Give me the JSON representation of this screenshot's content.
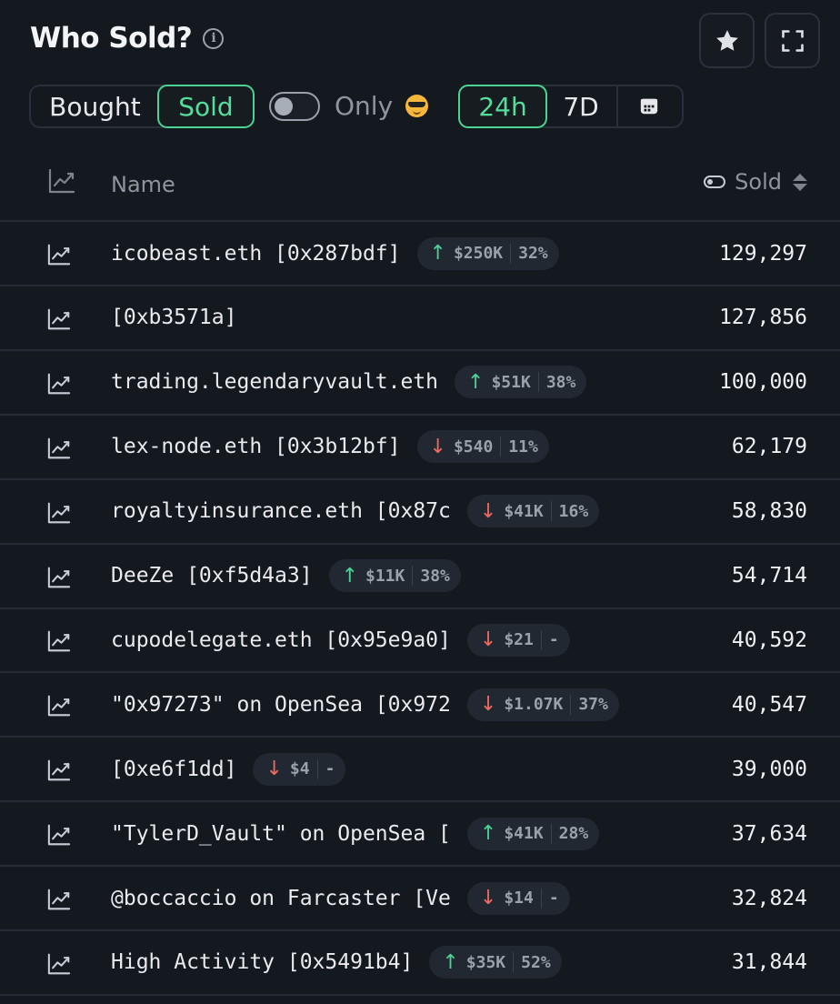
{
  "header": {
    "title": "Who Sold?",
    "info_icon": "info-icon",
    "favorite_icon": "star-icon",
    "fullscreen_icon": "expand-icon"
  },
  "filters": {
    "bought_label": "Bought",
    "sold_label": "Sold",
    "selected_side": "Sold",
    "only_toggle_on": false,
    "only_label": "Only",
    "only_icon": "cool-face-emoji-icon",
    "period_24h": "24h",
    "period_7d": "7D",
    "selected_period": "24h",
    "calendar_icon": "calendar-icon"
  },
  "table": {
    "col_name": "Name",
    "col_sold": "Sold",
    "rows": [
      {
        "name": "icobeast.eth [0x287bdf]",
        "dir": "up",
        "amount": "$250K",
        "pct": "32%",
        "value": "129,297"
      },
      {
        "name": "[0xb3571a]",
        "dir": null,
        "amount": "",
        "pct": "",
        "value": "127,856"
      },
      {
        "name": "trading.legendaryvault.eth",
        "dir": "up",
        "amount": "$51K",
        "pct": "38%",
        "value": "100,000"
      },
      {
        "name": "lex-node.eth [0x3b12bf]",
        "dir": "down",
        "amount": "$540",
        "pct": "11%",
        "value": "62,179"
      },
      {
        "name": "royaltyinsurance.eth [0x87c",
        "dir": "down",
        "amount": "$41K",
        "pct": "16%",
        "value": "58,830"
      },
      {
        "name": "DeeZe [0xf5d4a3]",
        "dir": "up",
        "amount": "$11K",
        "pct": "38%",
        "value": "54,714"
      },
      {
        "name": "cupodelegate.eth [0x95e9a0]",
        "dir": "down",
        "amount": "$21",
        "pct": "-",
        "value": "40,592"
      },
      {
        "name": "\"0x97273\" on OpenSea [0x972",
        "dir": "down",
        "amount": "$1.07K",
        "pct": "37%",
        "value": "40,547"
      },
      {
        "name": "[0xe6f1dd]",
        "dir": "down",
        "amount": "$4",
        "pct": "-",
        "value": "39,000"
      },
      {
        "name": "\"TylerD_Vault\" on OpenSea [",
        "dir": "up",
        "amount": "$41K",
        "pct": "28%",
        "value": "37,634"
      },
      {
        "name": "@boccaccio on Farcaster [Ve",
        "dir": "down",
        "amount": "$14",
        "pct": "-",
        "value": "32,824"
      },
      {
        "name": "High Activity [0x5491b4]",
        "dir": "up",
        "amount": "$35K",
        "pct": "52%",
        "value": "31,844"
      }
    ]
  },
  "colors": {
    "background": "#14181f",
    "accent_green": "#4ad493",
    "down_red": "#f0695f",
    "border": "#262b33"
  }
}
